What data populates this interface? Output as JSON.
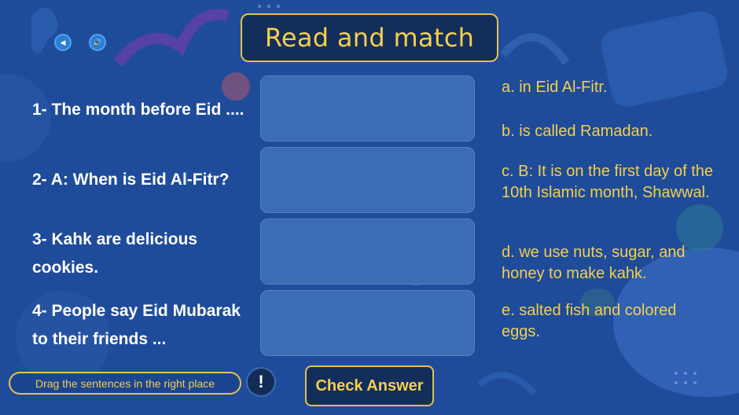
{
  "header": {
    "title": "Read and match"
  },
  "nav": {
    "back_icon": "back-arrow-icon",
    "sound_icon": "speaker-icon"
  },
  "prompts": [
    {
      "text": "1- The month before Eid ...."
    },
    {
      "text": "2- A: When is Eid Al-Fitr?"
    },
    {
      "text": "3- Kahk are delicious cookies."
    },
    {
      "text": "4- People say Eid Mubarak to their friends ..."
    }
  ],
  "answers": [
    {
      "text": "a. in Eid Al-Fitr."
    },
    {
      "text": "b. is called Ramadan."
    },
    {
      "text": "c. B: It is on the first day of the 10th Islamic month, Shawwal."
    },
    {
      "text": "d. we use nuts, sugar, and honey to make kahk."
    },
    {
      "text": "e. salted fish and colored eggs."
    }
  ],
  "footer": {
    "hint": "Drag the sentences in the right place",
    "info_symbol": "!",
    "check_label": "Check Answer"
  },
  "colors": {
    "background": "#1f4c9a",
    "accent": "#f4cf4e",
    "drop_zone": "#3a6db3",
    "dark_panel": "#142e5c"
  }
}
